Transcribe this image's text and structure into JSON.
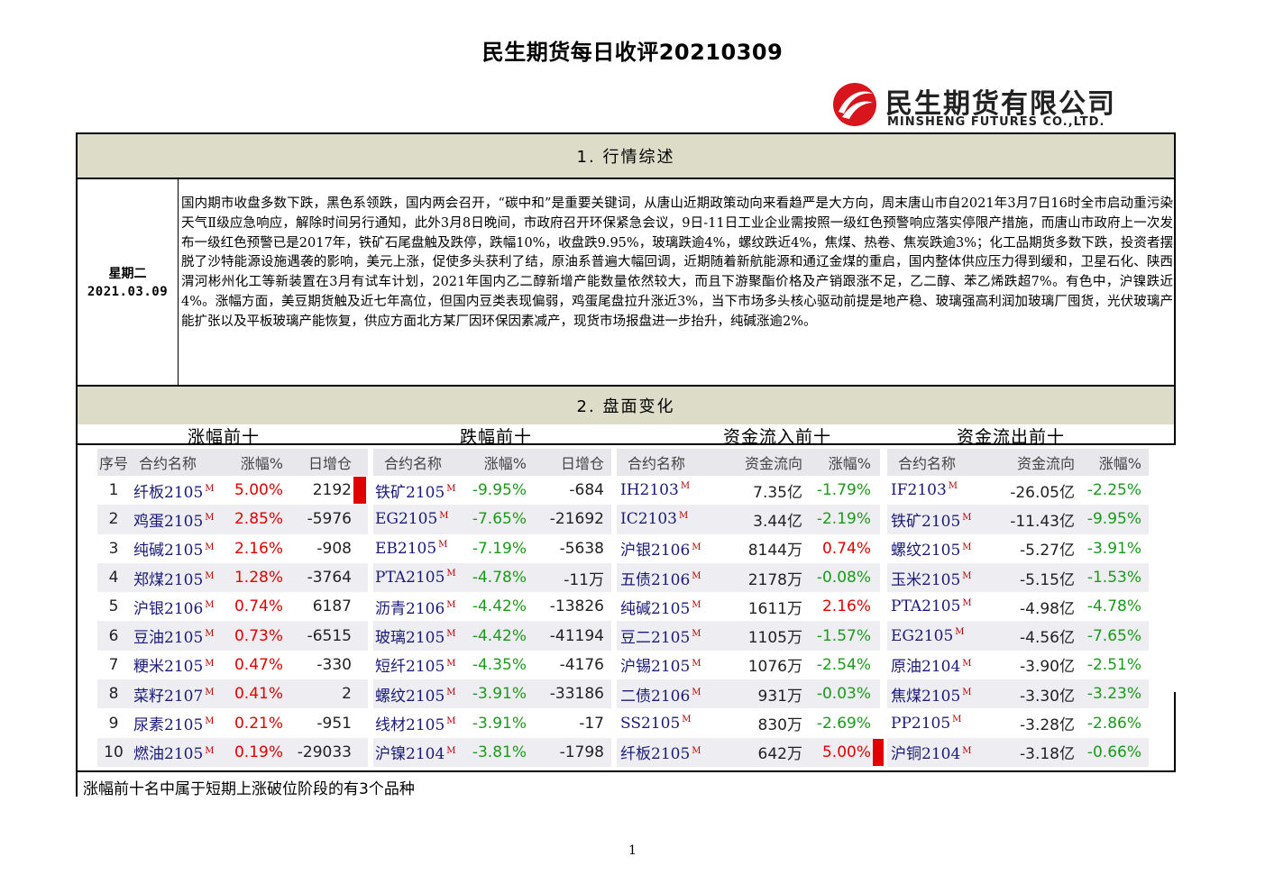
{
  "title": "民生期货每日收评20210309",
  "logo": {
    "cn": "民生期货有限公司",
    "en": "MINSHENG FUTURES CO.,LTD."
  },
  "section1": {
    "heading": "1. 行情综述"
  },
  "summary": {
    "weekday": "星期二",
    "date": "2021.03.09",
    "text": "国内期市收盘多数下跌，黑色系领跌，国内两会召开，“碳中和”是重要关键词，从唐山近期政策动向来看趋严是大方向，周末唐山市自2021年3月7日16时全市启动重污染天气Ⅱ级应急响应，解除时间另行通知，此外3月8日晚间，市政府召开环保紧急会议，9日-11日工业企业需按照一级红色预警响应落实停限产措施，而唐山市政府上一次发布一级红色预警已是2017年，铁矿石尾盘触及跌停，跌幅10%，收盘跌9.95%，玻璃跌逾4%，螺纹跌近4%，焦煤、热卷、焦炭跌逾3%；化工品期货多数下跌，投资者摆脱了沙特能源设施遇袭的影响，美元上涨，促使多头获利了结，原油系普遍大幅回调，近期随着新航能源和通辽金煤的重启，国内整体供应压力得到缓和，卫星石化、陕西渭河彬州化工等新装置在3月有试车计划，2021年国内乙二醇新增产能数量依然较大，而且下游聚酯价格及产销跟涨不足，乙二醇、苯乙烯跌超7%。有色中，沪镍跌近4%。涨幅方面，美豆期货触及近七年高位，但国内豆类表现偏弱，鸡蛋尾盘拉升涨近3%，当下市场多头核心驱动前提是地产稳、玻璃强高利润加玻璃厂囤货，光伏玻璃产能扩张以及平板玻璃产能恢复，供应方面北方某厂因环保因素减产，现货市场报盘进一步抬升，纯碱涨逾2%。"
  },
  "section2": {
    "heading": "2. 盘面变化"
  },
  "group_titles": [
    "涨幅前十",
    "跌幅前十",
    "资金流入前十",
    "资金流出前十"
  ],
  "gainers": {
    "headers": [
      "序号",
      "合约名称",
      "涨幅%",
      "日增仓"
    ],
    "rows": [
      {
        "no": "1",
        "name": "纤板2105",
        "pct": "5.00%",
        "oi": "2192",
        "flag": true
      },
      {
        "no": "2",
        "name": "鸡蛋2105",
        "pct": "2.85%",
        "oi": "-5976"
      },
      {
        "no": "3",
        "name": "纯碱2105",
        "pct": "2.16%",
        "oi": "-908"
      },
      {
        "no": "4",
        "name": "郑煤2105",
        "pct": "1.28%",
        "oi": "-3764"
      },
      {
        "no": "5",
        "name": "沪银2106",
        "pct": "0.74%",
        "oi": "6187"
      },
      {
        "no": "6",
        "name": "豆油2105",
        "pct": "0.73%",
        "oi": "-6515"
      },
      {
        "no": "7",
        "name": "粳米2105",
        "pct": "0.47%",
        "oi": "-330"
      },
      {
        "no": "8",
        "name": "菜籽2107",
        "pct": "0.41%",
        "oi": "2"
      },
      {
        "no": "9",
        "name": "尿素2105",
        "pct": "0.21%",
        "oi": "-951"
      },
      {
        "no": "10",
        "name": "燃油2105",
        "pct": "0.19%",
        "oi": "-29033"
      }
    ]
  },
  "losers": {
    "headers": [
      "合约名称",
      "涨幅%",
      "日增仓"
    ],
    "rows": [
      {
        "name": "铁矿2105",
        "pct": "-9.95%",
        "oi": "-684"
      },
      {
        "name": "EG2105",
        "pct": "-7.65%",
        "oi": "-21692"
      },
      {
        "name": "EB2105",
        "pct": "-7.19%",
        "oi": "-5638"
      },
      {
        "name": "PTA2105",
        "pct": "-4.78%",
        "oi": "-11万"
      },
      {
        "name": "沥青2106",
        "pct": "-4.42%",
        "oi": "-13826"
      },
      {
        "name": "玻璃2105",
        "pct": "-4.42%",
        "oi": "-41194"
      },
      {
        "name": "短纤2105",
        "pct": "-4.35%",
        "oi": "-4176"
      },
      {
        "name": "螺纹2105",
        "pct": "-3.91%",
        "oi": "-33186"
      },
      {
        "name": "线材2105",
        "pct": "-3.91%",
        "oi": "-17"
      },
      {
        "name": "沪镍2104",
        "pct": "-3.81%",
        "oi": "-1798"
      }
    ]
  },
  "inflow": {
    "headers": [
      "合约名称",
      "资金流向",
      "涨幅%"
    ],
    "rows": [
      {
        "name": "IH2103",
        "flow": "7.35亿",
        "pct": "-1.79%",
        "up": false
      },
      {
        "name": "IC2103",
        "flow": "3.44亿",
        "pct": "-2.19%",
        "up": false
      },
      {
        "name": "沪银2106",
        "flow": "8144万",
        "pct": "0.74%",
        "up": true
      },
      {
        "name": "五债2106",
        "flow": "2178万",
        "pct": "-0.08%",
        "up": false
      },
      {
        "name": "纯碱2105",
        "flow": "1611万",
        "pct": "2.16%",
        "up": true
      },
      {
        "name": "豆二2105",
        "flow": "1105万",
        "pct": "-1.57%",
        "up": false
      },
      {
        "name": "沪锡2105",
        "flow": "1076万",
        "pct": "-2.54%",
        "up": false
      },
      {
        "name": "二债2106",
        "flow": "931万",
        "pct": "-0.03%",
        "up": false
      },
      {
        "name": "SS2105",
        "flow": "830万",
        "pct": "-2.69%",
        "up": false
      },
      {
        "name": "纤板2105",
        "flow": "642万",
        "pct": "5.00%",
        "up": true,
        "flag": true
      }
    ]
  },
  "outflow": {
    "headers": [
      "合约名称",
      "资金流向",
      "涨幅%"
    ],
    "rows": [
      {
        "name": "IF2103",
        "flow": "-26.05亿",
        "pct": "-2.25%"
      },
      {
        "name": "铁矿2105",
        "flow": "-11.43亿",
        "pct": "-9.95%"
      },
      {
        "name": "螺纹2105",
        "flow": "-5.27亿",
        "pct": "-3.91%"
      },
      {
        "name": "玉米2105",
        "flow": "-5.15亿",
        "pct": "-1.53%"
      },
      {
        "name": "PTA2105",
        "flow": "-4.98亿",
        "pct": "-4.78%"
      },
      {
        "name": "EG2105",
        "flow": "-4.56亿",
        "pct": "-7.65%"
      },
      {
        "name": "原油2104",
        "flow": "-3.90亿",
        "pct": "-2.51%"
      },
      {
        "name": "焦煤2105",
        "flow": "-3.30亿",
        "pct": "-3.23%"
      },
      {
        "name": "PP2105",
        "flow": "-3.28亿",
        "pct": "-2.86%"
      },
      {
        "name": "沪铜2104",
        "flow": "-3.18亿",
        "pct": "-0.66%"
      }
    ]
  },
  "contract_marker": "M",
  "footer_note": "涨幅前十名中属于短期上涨破位阶段的有3个品种",
  "page_number": "1",
  "colors": {
    "up": "#e00000",
    "down": "#1a9a1a",
    "header_bg": "#dcdcc8",
    "logo_red": "#d8141c"
  },
  "icons": [
    "minsheng-logo-icon"
  ]
}
